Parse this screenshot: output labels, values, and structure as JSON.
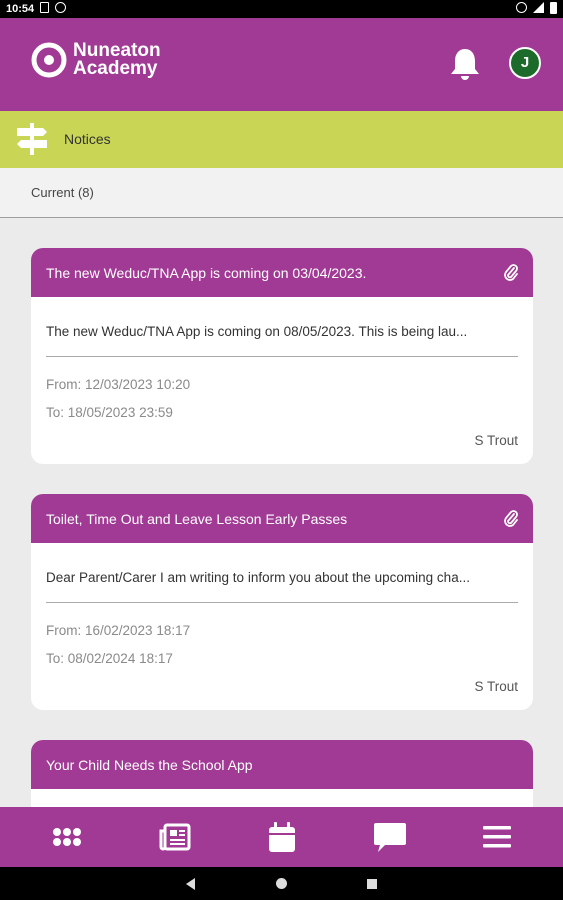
{
  "status_bar": {
    "time": "10:54"
  },
  "header": {
    "school_line1": "Nuneaton",
    "school_line2": "Academy",
    "avatar_initial": "J"
  },
  "section": {
    "title": "Notices"
  },
  "filter": {
    "label": "Current (8)"
  },
  "notices": [
    {
      "title": "The new Weduc/TNA App is coming on 03/04/2023.",
      "preview": "The new Weduc/TNA App is coming on 08/05/2023. This is being lau...",
      "from": "From: 12/03/2023 10:20",
      "to": "To: 18/05/2023 23:59",
      "author": "S Trout",
      "has_attachment": true
    },
    {
      "title": "Toilet, Time Out and Leave Lesson Early Passes",
      "preview": "Dear Parent/Carer I am writing to inform you about the upcoming cha...",
      "from": "From: 16/02/2023 18:17",
      "to": "To: 08/02/2024 18:17",
      "author": "S Trout",
      "has_attachment": true
    },
    {
      "title": "Your Child Needs the School App",
      "has_attachment": false
    }
  ],
  "bottom_nav": [
    "apps-grid-icon",
    "news-icon",
    "calendar-icon",
    "chat-icon",
    "menu-icon"
  ],
  "colors": {
    "brand": "#a13a94",
    "section_bar": "#c9d655",
    "avatar": "#1d6b2a"
  }
}
